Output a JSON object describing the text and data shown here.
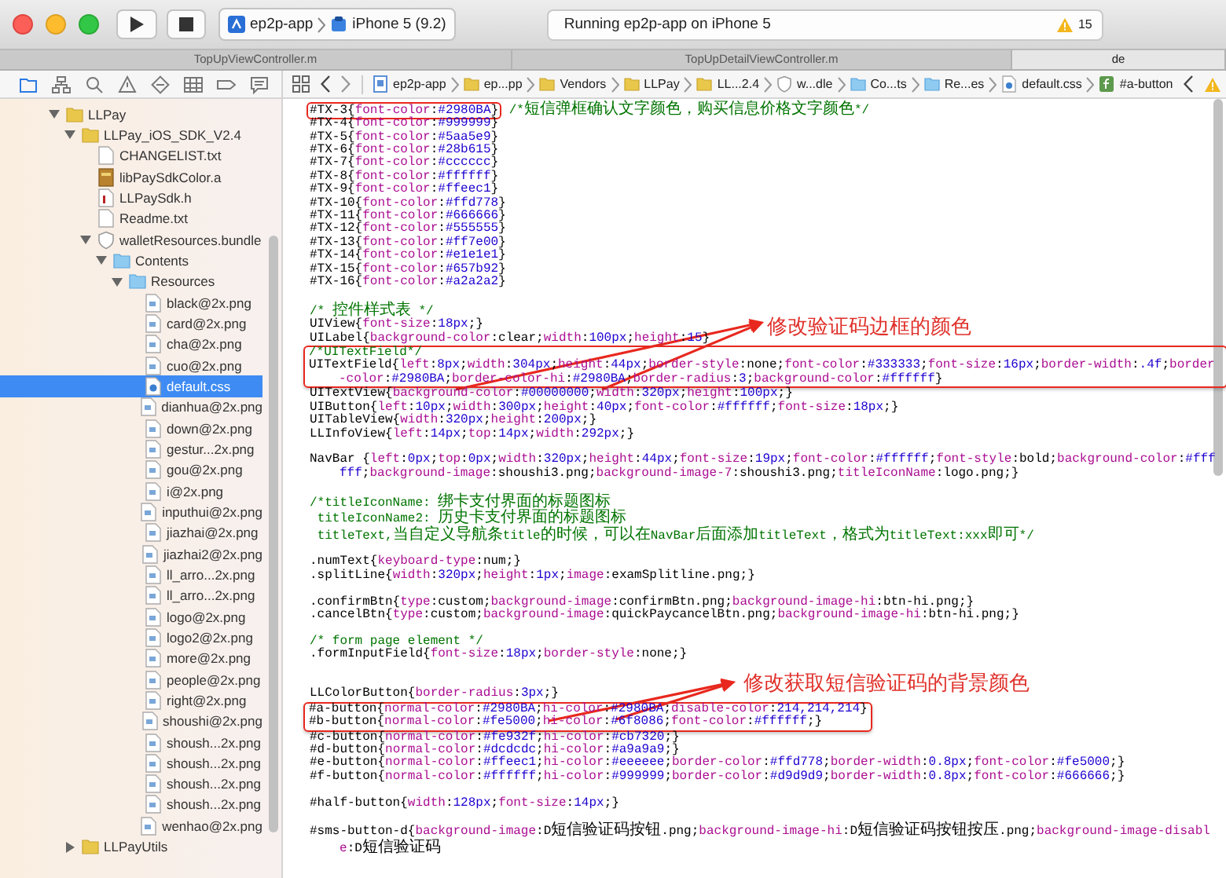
{
  "toolbar": {
    "scheme": {
      "project": "ep2p-app",
      "device": "iPhone 5 (9.2)"
    },
    "status": {
      "text": "Running ep2p-app on iPhone 5",
      "warnings": "15"
    }
  },
  "tabs": [
    {
      "label": "TopUpViewController.m",
      "selected": false
    },
    {
      "label": "TopUpDetailViewController.m",
      "selected": false
    },
    {
      "label": "de",
      "selected": true
    }
  ],
  "navigator_tabs": [
    {
      "kind": "folder",
      "selected": true
    },
    {
      "kind": "hierarchy",
      "selected": false
    },
    {
      "kind": "search",
      "selected": false
    },
    {
      "kind": "warning",
      "selected": false
    },
    {
      "kind": "test",
      "selected": false
    },
    {
      "kind": "debug",
      "selected": false
    },
    {
      "kind": "breakpoint",
      "selected": false
    },
    {
      "kind": "report",
      "selected": false
    }
  ],
  "sidebar": {
    "tree": [
      {
        "label": "LLPay",
        "kind": "folder",
        "expanded": true,
        "selected": false,
        "children": [
          {
            "label": "LLPay_iOS_SDK_V2.4",
            "kind": "folder",
            "expanded": true,
            "selected": false,
            "children": [
              {
                "label": "CHANGELIST.txt",
                "kind": "text",
                "selected": false
              },
              {
                "label": "libPaySdkColor.a",
                "kind": "library",
                "selected": false
              },
              {
                "label": "LLPaySdk.h",
                "kind": "header",
                "selected": false
              },
              {
                "label": "Readme.txt",
                "kind": "text",
                "selected": false
              },
              {
                "label": "walletResources.bundle",
                "kind": "bundle",
                "expanded": true,
                "selected": false,
                "children": [
                  {
                    "label": "Contents",
                    "kind": "blue-folder",
                    "expanded": true,
                    "selected": false,
                    "children": [
                      {
                        "label": "Resources",
                        "kind": "blue-folder",
                        "expanded": true,
                        "selected": false,
                        "children": [
                          {
                            "label": "black@2x.png",
                            "kind": "image",
                            "selected": false
                          },
                          {
                            "label": "card@2x.png",
                            "kind": "image",
                            "selected": false
                          },
                          {
                            "label": "cha@2x.png",
                            "kind": "image",
                            "selected": false
                          },
                          {
                            "label": "cuo@2x.png",
                            "kind": "image",
                            "selected": false
                          },
                          {
                            "label": "default.css",
                            "kind": "css",
                            "selected": true
                          },
                          {
                            "label": "dianhua@2x.png",
                            "kind": "image",
                            "selected": false
                          },
                          {
                            "label": "down@2x.png",
                            "kind": "image",
                            "selected": false
                          },
                          {
                            "label": "gestur...2x.png",
                            "kind": "image",
                            "selected": false
                          },
                          {
                            "label": "gou@2x.png",
                            "kind": "image",
                            "selected": false
                          },
                          {
                            "label": "i@2x.png",
                            "kind": "image",
                            "selected": false
                          },
                          {
                            "label": "inputhui@2x.png",
                            "kind": "image",
                            "selected": false
                          },
                          {
                            "label": "jiazhai@2x.png",
                            "kind": "image",
                            "selected": false
                          },
                          {
                            "label": "jiazhai2@2x.png",
                            "kind": "image",
                            "selected": false
                          },
                          {
                            "label": "ll_arro...2x.png",
                            "kind": "image",
                            "selected": false
                          },
                          {
                            "label": "ll_arro...2x.png",
                            "kind": "image",
                            "selected": false
                          },
                          {
                            "label": "logo@2x.png",
                            "kind": "image",
                            "selected": false
                          },
                          {
                            "label": "logo2@2x.png",
                            "kind": "image",
                            "selected": false
                          },
                          {
                            "label": "more@2x.png",
                            "kind": "image",
                            "selected": false
                          },
                          {
                            "label": "people@2x.png",
                            "kind": "image",
                            "selected": false
                          },
                          {
                            "label": "right@2x.png",
                            "kind": "image",
                            "selected": false
                          },
                          {
                            "label": "shoushi@2x.png",
                            "kind": "image",
                            "selected": false
                          },
                          {
                            "label": "shoush...2x.png",
                            "kind": "image",
                            "selected": false
                          },
                          {
                            "label": "shoush...2x.png",
                            "kind": "image",
                            "selected": false
                          },
                          {
                            "label": "shoush...2x.png",
                            "kind": "image",
                            "selected": false
                          },
                          {
                            "label": "shoush...2x.png",
                            "kind": "image",
                            "selected": false
                          },
                          {
                            "label": "wenhao@2x.png",
                            "kind": "image",
                            "selected": false
                          }
                        ]
                      }
                    ]
                  }
                ]
              }
            ]
          },
          {
            "label": "LLPayUtils",
            "kind": "folder",
            "expanded": false,
            "selected": false
          }
        ]
      }
    ]
  },
  "jump_bar": {
    "items": [
      {
        "label": "ep2p-app",
        "kind": "project"
      },
      {
        "label": "ep...pp",
        "kind": "folder"
      },
      {
        "label": "Vendors",
        "kind": "folder"
      },
      {
        "label": "LLPay",
        "kind": "folder"
      },
      {
        "label": "LL...2.4",
        "kind": "folder"
      },
      {
        "label": "w...dle",
        "kind": "bundle"
      },
      {
        "label": "Co...ts",
        "kind": "blue-folder"
      },
      {
        "label": "Re...es",
        "kind": "blue-folder"
      },
      {
        "label": "default.css",
        "kind": "css"
      },
      {
        "label": "#a-button",
        "kind": "symbol"
      }
    ]
  },
  "editor": {
    "blocks": [
      {
        "boxed": false,
        "lines": [
          {
            "kind": "code",
            "code": "#TX-3{font-color:#2980BA}",
            "comment": " /*短信弹框确认文字颜色，购买信息价格文字颜色*/",
            "marked": true
          },
          {
            "kind": "code",
            "code": "#TX-4{font-color:#999999}"
          },
          {
            "kind": "code",
            "code": "#TX-5{font-color:#5aa5e9}"
          },
          {
            "kind": "code",
            "code": "#TX-6{font-color:#28b615}"
          },
          {
            "kind": "code",
            "code": "#TX-7{font-color:#cccccc}"
          },
          {
            "kind": "code",
            "code": "#TX-8{font-color:#ffffff}"
          },
          {
            "kind": "code",
            "code": "#TX-9{font-color:#ffeec1}"
          },
          {
            "kind": "code",
            "code": "#TX-10{font-color:#ffd778}"
          },
          {
            "kind": "code",
            "code": "#TX-11{font-color:#666666}"
          },
          {
            "kind": "code",
            "code": "#TX-12{font-color:#555555}"
          },
          {
            "kind": "code",
            "code": "#TX-13{font-color:#ff7e00}"
          },
          {
            "kind": "code",
            "code": "#TX-14{font-color:#e1e1e1}"
          },
          {
            "kind": "code",
            "code": "#TX-15{font-color:#657b92}"
          },
          {
            "kind": "code",
            "code": "#TX-16{font-color:#a2a2a2}"
          },
          {
            "kind": "blank"
          },
          {
            "kind": "comment",
            "text": "/* 控件样式表 */"
          },
          {
            "kind": "code",
            "code": "UIView{font-size:18px;}"
          },
          {
            "kind": "code",
            "code": "UILabel{background-color:clear;width:100px;height:15}"
          }
        ]
      },
      {
        "boxed": true,
        "lines": [
          {
            "kind": "comment",
            "text": "/*UITextField*/"
          },
          {
            "kind": "code",
            "code": "UITextField{left:8px;width:304px;height:44px;border-style:none;font-color:#333333;font-size:16px;border-width:.4f;border-color:#2980BA;border-color-hi:#2980BA;border-radius:3;background-color:#ffffff}"
          }
        ]
      },
      {
        "boxed": false,
        "lines": [
          {
            "kind": "code",
            "code": "UITextView{background-color:#00000000;width:320px;height:100px;}"
          },
          {
            "kind": "code",
            "code": "UIButton{left:10px;width:300px;height:40px;font-color:#ffffff;font-size:18px;}"
          },
          {
            "kind": "code",
            "code": "UITableView{width:320px;height:200px;}"
          },
          {
            "kind": "code",
            "code": "LLInfoView{left:14px;top:14px;width:292px;}"
          },
          {
            "kind": "blank"
          },
          {
            "kind": "code",
            "code": "NavBar {left:0px;top:0px;width:320px;height:44px;font-size:19px;font-color:#ffffff;font-style:bold;background-color:#ffffff;background-image:shoushi3.png;background-image-7:shoushi3.png;titleIconName:logo.png;}"
          },
          {
            "kind": "blank"
          },
          {
            "kind": "comment",
            "text": "/*titleIconName: 绑卡支付界面的标题图标"
          },
          {
            "kind": "comment",
            "text": " titleIconName2: 历史卡支付界面的标题图标"
          },
          {
            "kind": "comment",
            "text": " titleText,当自定义导航条title的时候，可以在NavBar后面添加titleText，格式为titleText:xxx即可*/"
          },
          {
            "kind": "blank"
          },
          {
            "kind": "code",
            "code": ".numText{keyboard-type:num;}"
          },
          {
            "kind": "code",
            "code": ".splitLine{width:320px;height:1px;image:examSplitline.png;}"
          },
          {
            "kind": "blank"
          },
          {
            "kind": "code",
            "code": ".confirmBtn{type:custom;background-image:confirmBtn.png;background-image-hi:btn-hi.png;}"
          },
          {
            "kind": "code",
            "code": ".cancelBtn{type:custom;background-image:quickPaycancelBtn.png;background-image-hi:btn-hi.png;}"
          },
          {
            "kind": "blank"
          },
          {
            "kind": "comment",
            "text": "/* form page element */"
          },
          {
            "kind": "code",
            "code": ".formInputField{font-size:18px;border-style:none;}"
          },
          {
            "kind": "blank"
          },
          {
            "kind": "blank"
          },
          {
            "kind": "code",
            "code": "LLColorButton{border-radius:3px;}"
          }
        ]
      },
      {
        "boxed": true,
        "lines": [
          {
            "kind": "code",
            "code": "#a-button{normal-color:#2980BA;hi-color:#2980BA;disable-color:214,214,214}"
          },
          {
            "kind": "code",
            "code": "#b-button{normal-color:#fe5000;hi-color:#6f8086;font-color:#ffffff;}"
          }
        ]
      },
      {
        "boxed": false,
        "lines": [
          {
            "kind": "code",
            "code": "#c-button{normal-color:#fe932f;hi-color:#cb7320;}"
          },
          {
            "kind": "code",
            "code": "#d-button{normal-color:#dcdcdc;hi-color:#a9a9a9;}"
          },
          {
            "kind": "code",
            "code": "#e-button{normal-color:#ffeec1;hi-color:#eeeeee;border-color:#ffd778;border-width:0.8px;font-color:#fe5000;}"
          },
          {
            "kind": "code",
            "code": "#f-button{normal-color:#ffffff;hi-color:#999999;border-color:#d9d9d9;border-width:0.8px;font-color:#666666;}"
          },
          {
            "kind": "blank"
          },
          {
            "kind": "code",
            "code": "#half-button{width:128px;font-size:14px;}"
          },
          {
            "kind": "blank"
          },
          {
            "kind": "code",
            "code": "#sms-button-d{background-image:D短信验证码按钮.png;background-image-hi:D短信验证码按钮按压.png;background-image-disable:D短信验证码"
          }
        ]
      }
    ],
    "annotations": [
      {
        "text": "修改验证码边框的颜色"
      },
      {
        "text": "修改获取短信验证码的背景颜色"
      }
    ]
  }
}
